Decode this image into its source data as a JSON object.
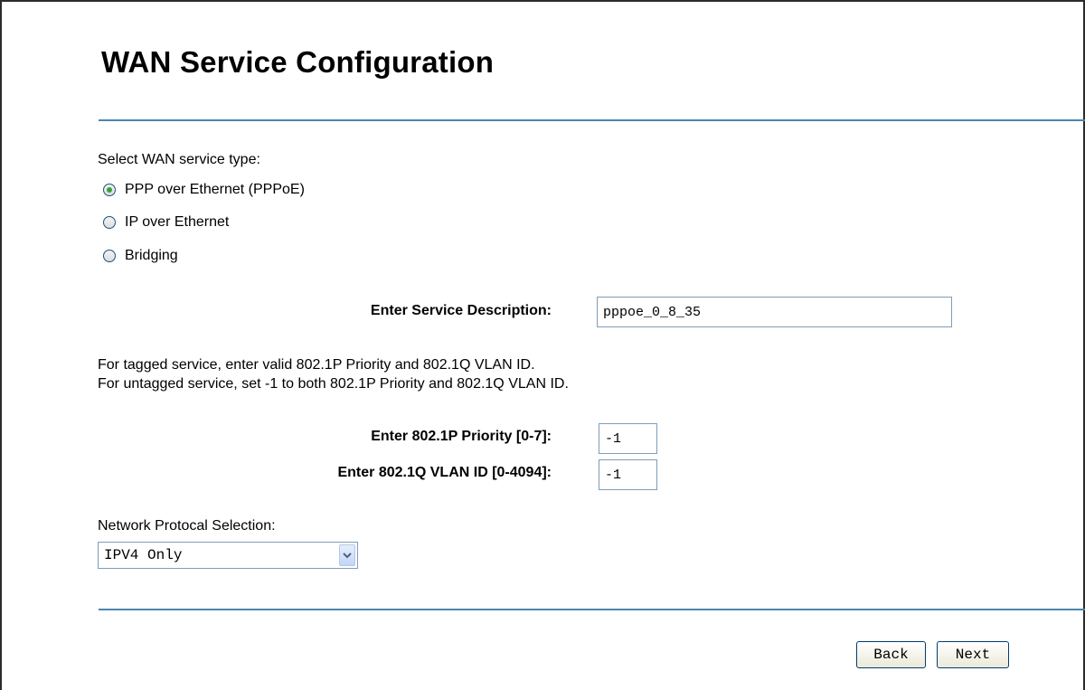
{
  "page": {
    "title": "WAN Service Configuration"
  },
  "service_type": {
    "label": "Select WAN service type:",
    "options": [
      {
        "label": "PPP over Ethernet (PPPoE)",
        "checked": true
      },
      {
        "label": "IP over Ethernet",
        "checked": false
      },
      {
        "label": "Bridging",
        "checked": false
      }
    ]
  },
  "description": {
    "label": "Enter Service Description:",
    "value": "pppoe_0_8_35"
  },
  "vlan_notes": {
    "tagged": "For tagged service, enter valid 802.1P Priority and 802.1Q VLAN ID.",
    "untagged": "For untagged service, set -1 to both 802.1P Priority and 802.1Q VLAN ID."
  },
  "priority": {
    "label": "Enter 802.1P Priority [0-7]:",
    "value": "-1"
  },
  "vlan_id": {
    "label": "Enter 802.1Q VLAN ID [0-4094]:",
    "value": "-1"
  },
  "protocol": {
    "label": "Network Protocal Selection:",
    "selected": "IPV4 Only"
  },
  "buttons": {
    "back": "Back",
    "next": "Next"
  },
  "colors": {
    "rule": "#4a86b0",
    "radio_dot": "#3aa13a",
    "input_border": "#7f9db9"
  }
}
